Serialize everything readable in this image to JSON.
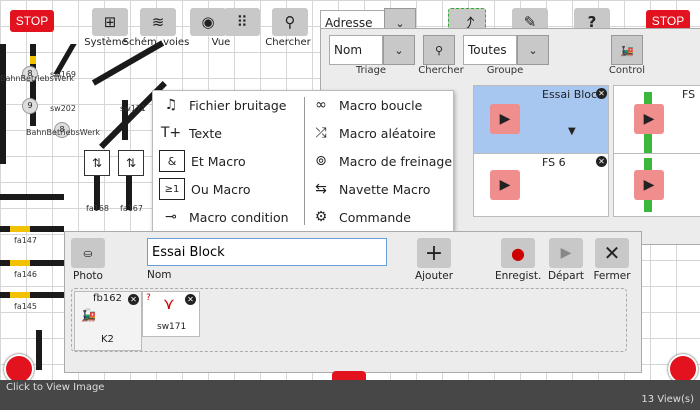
{
  "toolbar": {
    "stop_label": "STOP",
    "systeme_label": "Système",
    "schem_label": "Schém. voies",
    "vue_label": "Vue",
    "chercher_label": "Chercher",
    "adresse_label": "Adresse"
  },
  "layout_labels": {
    "bahn1": "BahnBetriebsWerk",
    "bahn2": "BahnBetriebsWerk",
    "sw169": "sw169",
    "sw202": "sw202",
    "sw171": "sw171",
    "fa168": "fa168",
    "fa167": "fa167",
    "fa147": "fa147",
    "fa146": "fa146",
    "fa145": "fa145",
    "n8": "8",
    "n9": "9",
    "n8b": "8"
  },
  "context_menu": {
    "left": [
      {
        "label": "Fichier bruitage",
        "icon": "sound-file-icon"
      },
      {
        "label": "Texte",
        "icon": "text-icon"
      },
      {
        "label": "Et Macro",
        "icon": "and-macro-icon"
      },
      {
        "label": "Ou Macro",
        "icon": "or-macro-icon"
      },
      {
        "label": "Macro condition",
        "icon": "condition-icon"
      }
    ],
    "right": [
      {
        "label": "Macro boucle",
        "icon": "loop-icon"
      },
      {
        "label": "Macro aléatoire",
        "icon": "shuffle-icon"
      },
      {
        "label": "Macro de freinage",
        "icon": "brake-icon"
      },
      {
        "label": "Navette Macro",
        "icon": "shuttle-icon"
      },
      {
        "label": "Commande",
        "icon": "command-icon"
      }
    ]
  },
  "macro_panel": {
    "triage_value": "Nom",
    "triage_label": "Triage",
    "chercher_label": "Chercher",
    "groupe_value": "Toutes",
    "groupe_label": "Groupe",
    "control_label": "Control",
    "cards": [
      {
        "title": "Essai Block"
      },
      {
        "title": "FS"
      },
      {
        "title": "FS 6"
      }
    ]
  },
  "editor": {
    "photo_label": "Photo",
    "name_value": "Essai Block",
    "name_label": "Nom",
    "add_label": "Ajouter",
    "record_label": "Enregist.",
    "start_label": "Départ",
    "close_label": "Fermer",
    "steps": [
      {
        "id": "fb162",
        "sub": "K2"
      },
      {
        "id": "sw171"
      }
    ]
  },
  "status": {
    "left": "Click to View Image",
    "right": "13 View(s)"
  },
  "colors": {
    "stop_red": "#e2121e",
    "track_yellow": "#f2c200",
    "selected_card": "#a7c6f0",
    "play_pink": "#f08d8d"
  }
}
